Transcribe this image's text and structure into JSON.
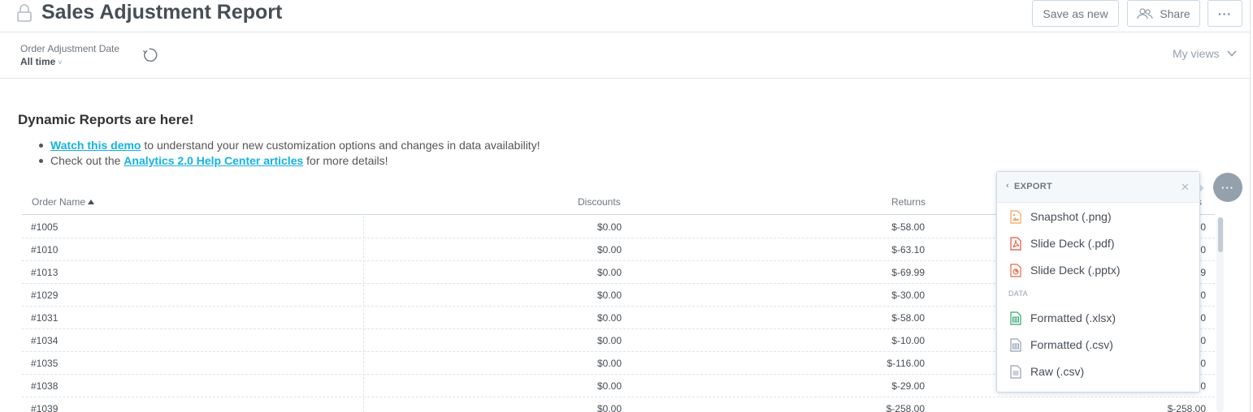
{
  "header": {
    "title": "Sales Adjustment Report",
    "save_as_new": "Save as new",
    "share": "Share",
    "more": "···"
  },
  "filter": {
    "label": "Order Adjustment Date",
    "value": "All time",
    "my_views": "My views"
  },
  "notice": {
    "title": "Dynamic Reports are here!",
    "item1_link": "Watch this demo",
    "item1_text": " to understand your new customization options and changes in data availability!",
    "item2_prefix": "Check out the ",
    "item2_link": "Analytics 2.0 Help Center articles",
    "item2_suffix": " for more details!"
  },
  "table": {
    "columns": [
      "Order Name",
      "Discounts",
      "Returns",
      "s"
    ],
    "rows": [
      [
        "#1005",
        "$0.00",
        "$-58.00",
        "0"
      ],
      [
        "#1010",
        "$0.00",
        "$-63.10",
        "0"
      ],
      [
        "#1013",
        "$0.00",
        "$-69.99",
        "9"
      ],
      [
        "#1029",
        "$0.00",
        "$-30.00",
        "0"
      ],
      [
        "#1031",
        "$0.00",
        "$-58.00",
        "0"
      ],
      [
        "#1034",
        "$0.00",
        "$-10.00",
        "0"
      ],
      [
        "#1035",
        "$0.00",
        "$-116.00",
        "0"
      ],
      [
        "#1038",
        "$0.00",
        "$-29.00",
        "0"
      ],
      [
        "#1039",
        "$0.00",
        "$-258.00",
        "$-258.00"
      ]
    ]
  },
  "export_menu": {
    "kebab": "···",
    "back": "‹",
    "title": "EXPORT",
    "close": "✕",
    "section_data": "DATA",
    "items": [
      {
        "label": "Snapshot (.png)",
        "icon": "image-file-icon"
      },
      {
        "label": "Slide Deck (.pdf)",
        "icon": "pdf-file-icon"
      },
      {
        "label": "Slide Deck (.pptx)",
        "icon": "pptx-file-icon"
      },
      {
        "label": "Formatted (.xlsx)",
        "icon": "xlsx-file-icon"
      },
      {
        "label": "Formatted (.csv)",
        "icon": "csv-file-icon"
      },
      {
        "label": "Raw (.csv)",
        "icon": "raw-csv-file-icon"
      }
    ]
  },
  "colors": {
    "link": "#14b2e2",
    "text": "#464e56",
    "muted": "#94a1ad",
    "border": "#ccd8e2"
  }
}
